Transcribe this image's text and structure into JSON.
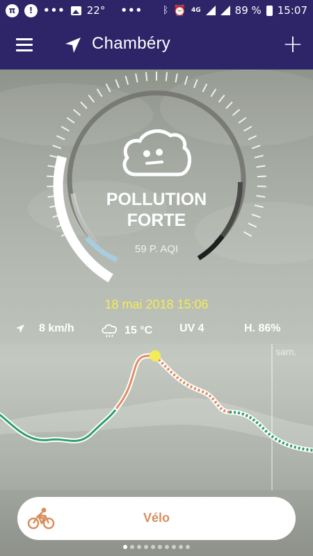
{
  "status_bar": {
    "pi_badge": "π",
    "alert_badge": "!",
    "dots": "•••",
    "temperature": "22°",
    "more": "•••",
    "network": "4G",
    "battery_percent": "89 %",
    "time": "15:07"
  },
  "header": {
    "city": "Chambéry",
    "add_label": "+"
  },
  "pollution": {
    "level_line1": "POLLUTION",
    "level_line2": "FORTE",
    "aqi_label": "59 P. AQI",
    "aqi_value": 59
  },
  "date": "18 mai 2018 15:06",
  "weather": {
    "wind": "8 km/h",
    "temperature": "15 °C",
    "uv": "UV 4",
    "humidity": "H. 86%"
  },
  "forecast": {
    "day_label": "sam."
  },
  "mode": {
    "label": "Vélo",
    "icon": "bicycle-icon"
  },
  "pager": {
    "count": 10,
    "active_index": 0
  },
  "colors": {
    "header_bg": "#2d2568",
    "date_yellow": "#f3ec57",
    "accent_orange": "#d98e5f",
    "good_green": "#2e9e6e"
  }
}
